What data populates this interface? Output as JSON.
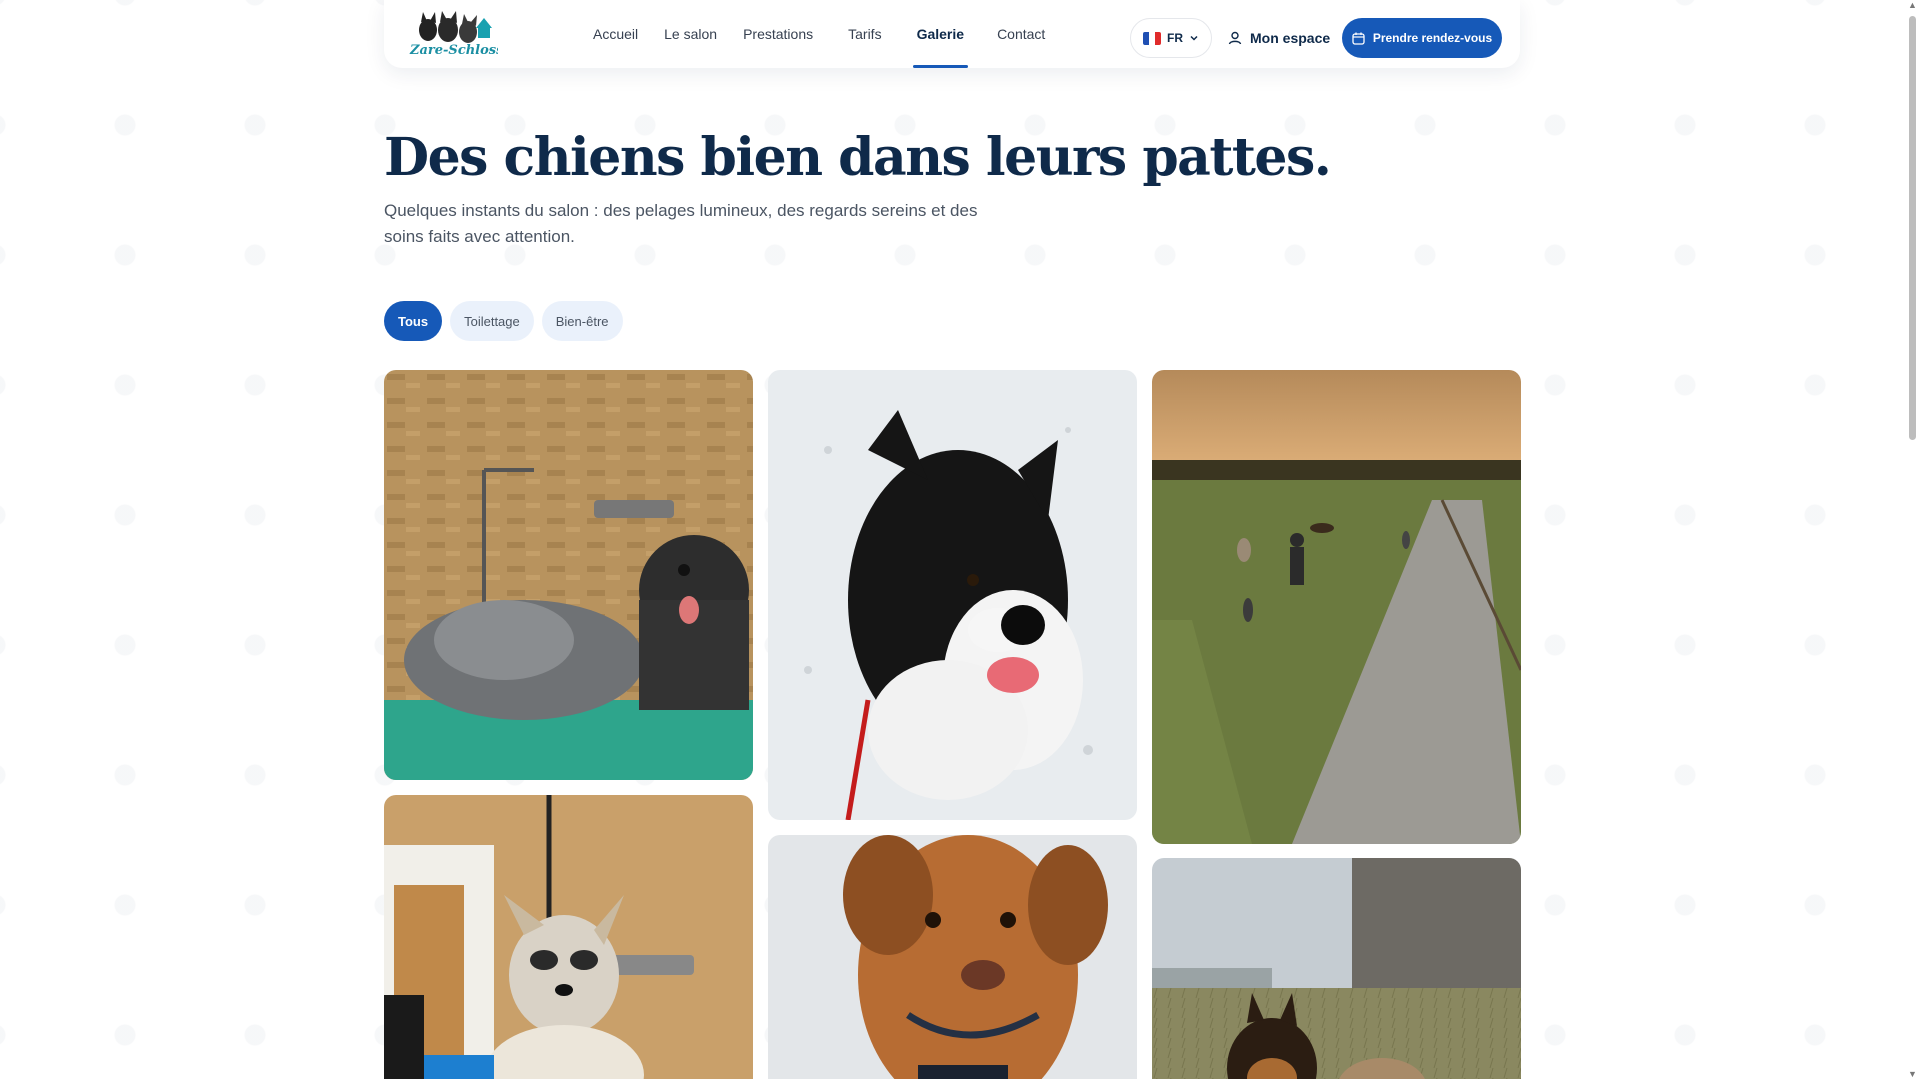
{
  "brand": {
    "logo_text": "Zare-Schloss"
  },
  "nav": {
    "items": [
      {
        "label": "Accueil"
      },
      {
        "label": "Le salon"
      },
      {
        "label": "Prestations"
      },
      {
        "label": "Tarifs"
      },
      {
        "label": "Galerie",
        "active": true
      },
      {
        "label": "Contact"
      }
    ]
  },
  "lang": {
    "code": "FR",
    "icon": "chevron-down-icon"
  },
  "account": {
    "label": "Mon espace",
    "icon": "user-icon"
  },
  "cta": {
    "label": "Prendre rendez-vous",
    "icon": "calendar-icon"
  },
  "hero": {
    "title": "Des chiens bien dans leurs pattes.",
    "subtitle": "Quelques instants du salon : des pelages lumineux, des regards sereins et des soins faits avec attention."
  },
  "filters": [
    {
      "label": "Tous",
      "active": true
    },
    {
      "label": "Toilettage"
    },
    {
      "label": "Bien-être"
    }
  ],
  "colors": {
    "primary": "#1659b8",
    "navy": "#0f2a4a",
    "chip_bg": "#eaf1fb"
  }
}
